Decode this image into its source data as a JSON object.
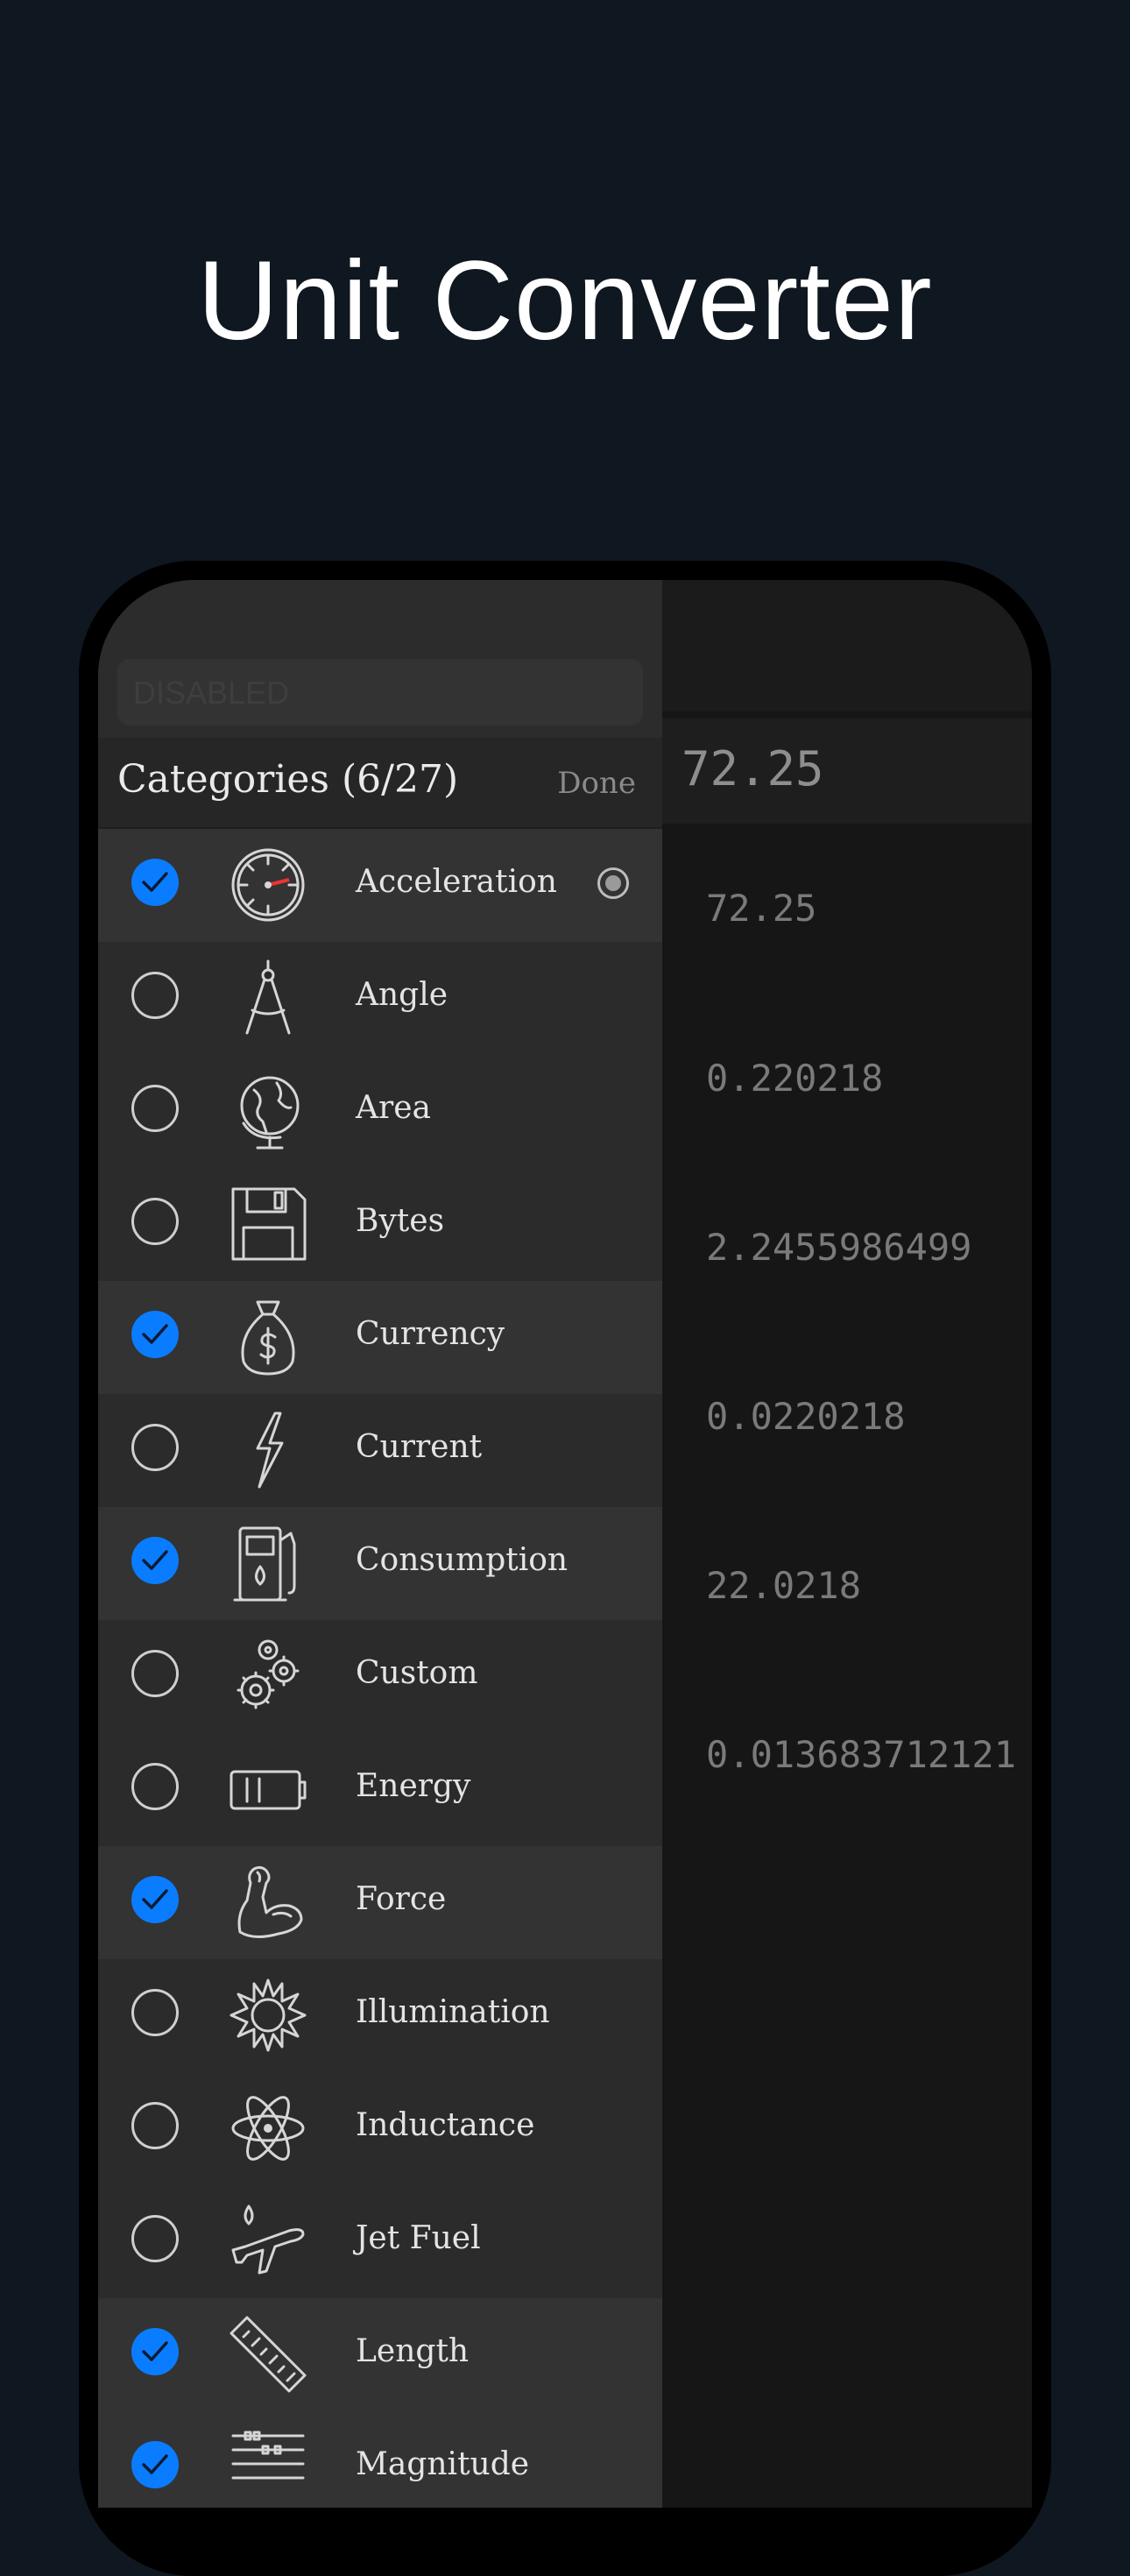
{
  "headline": "Unit Converter",
  "search": {
    "placeholder": "DISABLED"
  },
  "panel": {
    "title": "Categories (6/27)",
    "done_label": "Done"
  },
  "categories": [
    {
      "label": "Acceleration",
      "checked": true,
      "icon": "speedometer-icon"
    },
    {
      "label": "Angle",
      "checked": false,
      "icon": "compass-icon"
    },
    {
      "label": "Area",
      "checked": false,
      "icon": "globe-icon"
    },
    {
      "label": "Bytes",
      "checked": false,
      "icon": "floppy-disk-icon"
    },
    {
      "label": "Currency",
      "checked": true,
      "icon": "money-bag-icon"
    },
    {
      "label": "Current",
      "checked": false,
      "icon": "lightning-icon"
    },
    {
      "label": "Consumption",
      "checked": true,
      "icon": "fuel-pump-icon"
    },
    {
      "label": "Custom",
      "checked": false,
      "icon": "gears-icon"
    },
    {
      "label": "Energy",
      "checked": false,
      "icon": "battery-icon"
    },
    {
      "label": "Force",
      "checked": true,
      "icon": "flexed-arm-icon"
    },
    {
      "label": "Illumination",
      "checked": false,
      "icon": "sun-icon"
    },
    {
      "label": "Inductance",
      "checked": false,
      "icon": "atom-icon"
    },
    {
      "label": "Jet Fuel",
      "checked": false,
      "icon": "airplane-icon"
    },
    {
      "label": "Length",
      "checked": true,
      "icon": "ruler-icon"
    },
    {
      "label": "Magnitude",
      "checked": true,
      "icon": "abacus-icon"
    }
  ],
  "converter": {
    "input_value": "72.25",
    "results": [
      "72.25",
      "0.220218",
      "2.2455986499",
      "0.0220218",
      "22.0218",
      "0.013683712121"
    ]
  },
  "colors": {
    "accent": "#0a7cff",
    "background": "#0f1720"
  }
}
